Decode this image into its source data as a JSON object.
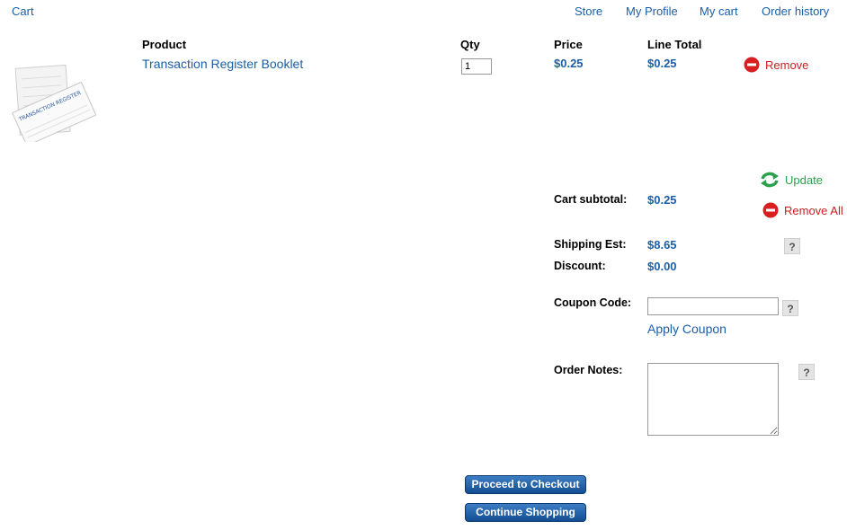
{
  "nav": {
    "breadcrumb": "Cart",
    "links": [
      "Store",
      "My Profile",
      "My cart",
      "Order history"
    ]
  },
  "table": {
    "headers": {
      "product": "Product",
      "qty": "Qty",
      "price": "Price",
      "line_total": "Line Total"
    },
    "items": [
      {
        "thumbnail_text": "TRANSACTION REGISTER",
        "name": "Transaction Register Booklet",
        "qty": "1",
        "price": "$0.25",
        "line_total": "$0.25",
        "remove_label": "Remove"
      }
    ]
  },
  "actions": {
    "update_label": "Update",
    "remove_all_label": "Remove All"
  },
  "summary": {
    "cart_subtotal_label": "Cart subtotal:",
    "cart_subtotal": "$0.25",
    "shipping_label": "Shipping Est:",
    "shipping": "$8.65",
    "discount_label": "Discount:",
    "discount": "$0.00",
    "coupon_label": "Coupon Code:",
    "coupon_value": "",
    "apply_coupon_label": "Apply Coupon",
    "order_notes_label": "Order Notes:",
    "help_glyph": "?"
  },
  "buttons": {
    "checkout": "Proceed to Checkout",
    "continue": "Continue Shopping"
  },
  "colors": {
    "link": "#1a5fa8",
    "remove": "#cc1f1f",
    "update": "#2aa04a",
    "button": "#1a5295"
  }
}
